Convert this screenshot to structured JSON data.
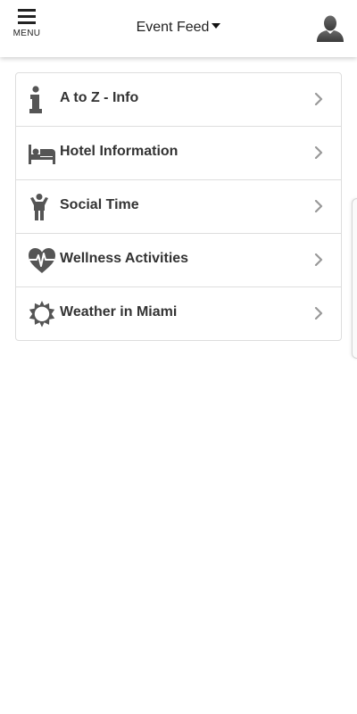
{
  "header": {
    "menu_label": "MENU",
    "feed_selector": "Event Feed"
  },
  "list": {
    "items": [
      {
        "label": "A to Z - Info",
        "icon": "info-icon"
      },
      {
        "label": "Hotel Information",
        "icon": "bed-icon"
      },
      {
        "label": "Social Time",
        "icon": "person-icon"
      },
      {
        "label": "Wellness Activities",
        "icon": "heart-pulse-icon"
      },
      {
        "label": "Weather in Miami",
        "icon": "sun-icon"
      }
    ]
  },
  "colors": {
    "icon": "#555555",
    "text": "#333333",
    "chevron": "#999999",
    "divider": "#dddddd"
  }
}
